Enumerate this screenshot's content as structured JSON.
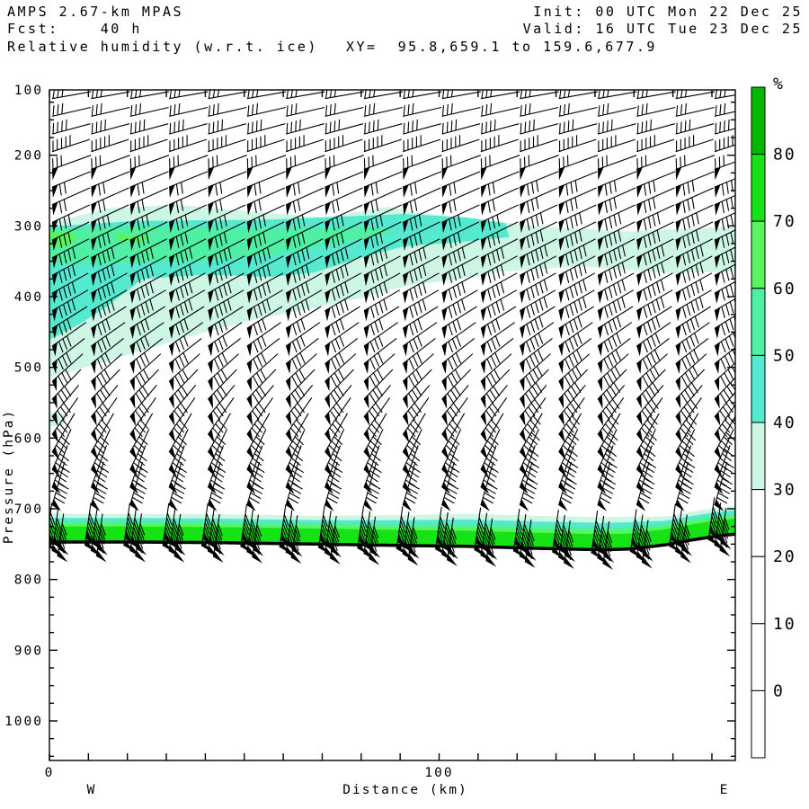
{
  "header": {
    "model_line": "AMPS 2.67-km MPAS",
    "fcst_line": "Fcst:    40 h",
    "field_line": "Relative humidity (w.r.t. ice)",
    "init_line": "Init: 00 UTC Mon 22 Dec 25",
    "valid_line": "Valid: 16 UTC Tue 23 Dec 25",
    "xy_line": "XY=  95.8,659.1 to 159.6,677.9"
  },
  "chart_data": {
    "type": "heatmap",
    "subtype": "vertical-cross-section with wind barbs",
    "title": "Relative humidity (w.r.t. ice)",
    "xlabel": "Distance (km)",
    "ylabel": "Pressure (hPa)",
    "x_axis": {
      "range_km": [
        0,
        176
      ],
      "tick_step_km": 10,
      "labeled_ticks": [
        {
          "km": 0,
          "label": "0"
        },
        {
          "km": 100,
          "label": "100"
        }
      ],
      "west_label": "W",
      "east_label": "E"
    },
    "y_axis": {
      "range_hpa": [
        100,
        1055
      ],
      "major_ticks": [
        100,
        200,
        300,
        400,
        500,
        600,
        700,
        800,
        900,
        1000
      ],
      "major_labels": [
        "100",
        "200",
        "300",
        "400",
        "500",
        "600",
        "700",
        "800",
        "900",
        "1000"
      ],
      "minor_step_hpa": 25
    },
    "colorbar": {
      "unit": "%",
      "boundary_labels": [
        "80",
        "70",
        "60",
        "50",
        "40",
        "30",
        "20",
        "10",
        "0"
      ],
      "segment_colors_top_to_bottom": [
        "#00b800",
        "#16e316",
        "#58f55f",
        "#4fefa4",
        "#55ead0",
        "#cdf6e5",
        "#ffffff",
        "#ffffff",
        "#ffffff",
        "#ffffff"
      ]
    },
    "palette": {
      "30": "#cdf6e5",
      "40": "#55ead0",
      "50": "#4fefa4",
      "60": "#58f55f",
      "70": "#16e316",
      "80": "#00b800"
    },
    "humidity_regions": [
      {
        "level": "30",
        "points": [
          [
            0,
            296
          ],
          [
            15,
            275
          ],
          [
            33,
            270
          ],
          [
            54,
            281
          ],
          [
            70,
            288
          ],
          [
            87,
            273
          ],
          [
            94,
            281
          ],
          [
            110,
            291
          ],
          [
            126,
            301
          ],
          [
            149,
            308
          ],
          [
            176,
            301
          ],
          [
            176,
            364
          ],
          [
            160,
            367
          ],
          [
            137,
            357
          ],
          [
            117,
            364
          ],
          [
            103,
            377
          ],
          [
            91,
            385
          ],
          [
            80,
            402
          ],
          [
            66,
            418
          ],
          [
            52,
            433
          ],
          [
            38,
            453
          ],
          [
            24,
            476
          ],
          [
            10,
            499
          ],
          [
            0,
            514
          ]
        ]
      },
      {
        "level": "30",
        "points": [
          [
            0,
            563
          ],
          [
            4.6,
            568
          ],
          [
            3.5,
            581
          ],
          [
            0,
            584
          ]
        ]
      },
      {
        "level": "40",
        "points": [
          [
            0,
            301
          ],
          [
            22,
            293
          ],
          [
            57,
            291
          ],
          [
            91,
            283
          ],
          [
            107,
            288
          ],
          [
            117,
            296
          ],
          [
            118,
            316
          ],
          [
            103,
            324
          ],
          [
            91,
            329
          ],
          [
            80,
            345
          ],
          [
            68,
            366
          ],
          [
            57,
            372
          ],
          [
            40,
            369
          ],
          [
            24,
            375
          ],
          [
            15,
            413
          ],
          [
            8,
            438
          ],
          [
            0,
            461
          ]
        ]
      },
      {
        "level": "50",
        "points": [
          [
            0,
            305
          ],
          [
            22,
            300
          ],
          [
            57,
            303
          ],
          [
            84,
            302
          ],
          [
            88,
            310
          ],
          [
            77,
            322
          ],
          [
            57,
            341
          ],
          [
            36,
            350
          ],
          [
            15,
            354
          ],
          [
            0,
            353
          ]
        ]
      },
      {
        "level": "60",
        "points": [
          [
            0,
            307
          ],
          [
            6,
            309
          ],
          [
            7,
            321
          ],
          [
            3,
            331
          ],
          [
            0,
            329
          ]
        ]
      },
      {
        "level": "60",
        "points": [
          [
            17,
            311
          ],
          [
            25,
            314
          ],
          [
            24,
            324
          ],
          [
            18,
            321
          ]
        ]
      }
    ],
    "terrain_profile": [
      [
        0,
        747
      ],
      [
        22,
        747
      ],
      [
        45,
        748
      ],
      [
        68,
        750
      ],
      [
        91,
        752
      ],
      [
        107,
        753
      ],
      [
        126,
        756
      ],
      [
        142,
        758
      ],
      [
        149,
        757
      ],
      [
        158,
        751
      ],
      [
        165,
        744
      ],
      [
        172,
        738
      ],
      [
        176,
        736
      ]
    ],
    "surface_moist_layers": [
      {
        "level": "30",
        "dp": 40,
        "bump": 6
      },
      {
        "level": "40",
        "dp": 34,
        "bump": 4
      },
      {
        "level": "50",
        "dp": 30,
        "bump": 2
      },
      {
        "level": "60",
        "dp": 26,
        "bump": 1
      },
      {
        "level": "70",
        "dp": 22,
        "bump": 0
      }
    ],
    "wind_field": {
      "columns_km_start": 0.7,
      "columns_km_step": 10,
      "columns_count": 18,
      "rows": [
        {
          "p": 120,
          "a": 10,
          "up": 3
        },
        {
          "p": 145,
          "a": 13,
          "up": 3
        },
        {
          "p": 170,
          "a": 15,
          "up": 4
        },
        {
          "p": 195,
          "a": 18,
          "up": 5
        },
        {
          "p": 220,
          "a": 20,
          "up": 3,
          "pen": 1
        },
        {
          "p": 245,
          "a": 22,
          "dn": 2,
          "pen": 1
        },
        {
          "p": 270,
          "a": 24,
          "dn": 2,
          "pen": 1
        },
        {
          "p": 295,
          "a": 25,
          "dn": 3,
          "pen": 1
        },
        {
          "p": 320,
          "a": 26,
          "dn": 3,
          "pen": 1
        },
        {
          "p": 345,
          "a": 27,
          "dn": 4,
          "pen": 1
        },
        {
          "p": 370,
          "a": 28,
          "dn": 4,
          "pen": 1
        },
        {
          "p": 395,
          "a": 29,
          "dn": 4,
          "pen": 1
        },
        {
          "p": 420,
          "a": 30,
          "dn": 4,
          "pen": 1
        },
        {
          "p": 445,
          "a": 32,
          "dn": 3,
          "pen": 1
        },
        {
          "p": 470,
          "a": 35,
          "dn": 3,
          "pen": 1
        },
        {
          "p": 495,
          "a": 38,
          "dn": 3,
          "pen": 1
        },
        {
          "p": 520,
          "a": 42,
          "dn": 3,
          "pen": 1
        },
        {
          "p": 545,
          "a": 46,
          "dn": 3,
          "pen": 1
        },
        {
          "p": 570,
          "a": 50,
          "dn": 3,
          "pen": 1
        },
        {
          "p": 595,
          "a": 55,
          "dn": 3,
          "pen": 1
        },
        {
          "p": 620,
          "a": 60,
          "dn": 3,
          "pen": 1
        },
        {
          "p": 645,
          "a": 65,
          "dn": 3,
          "pen": 1
        },
        {
          "p": 670,
          "a": 70,
          "dn": 4,
          "pen": 1
        },
        {
          "p": 695,
          "a": 74,
          "dn": 4,
          "pen": 1
        }
      ],
      "surface_cluster": {
        "a": 82,
        "pen": 2,
        "dn": 5,
        "offsets": [
          [
            -7,
            4
          ],
          [
            0,
            10
          ],
          [
            6,
            16
          ]
        ]
      }
    }
  }
}
